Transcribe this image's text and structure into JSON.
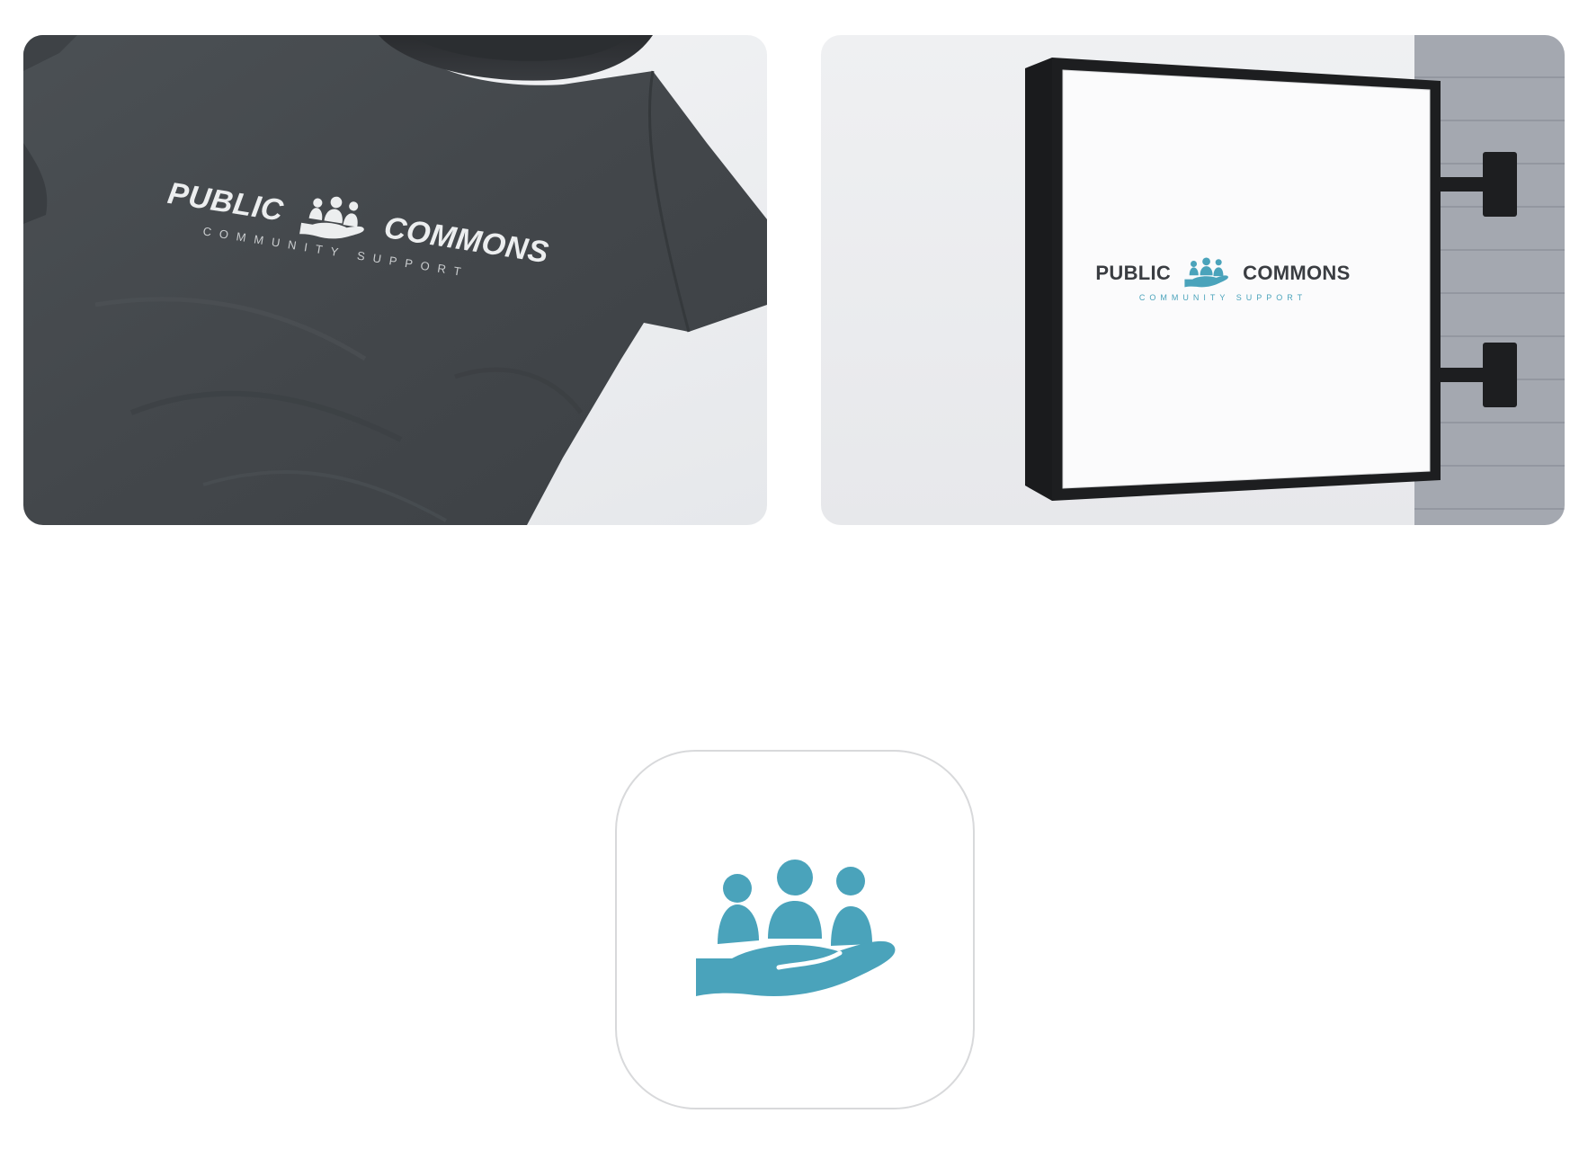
{
  "brand": {
    "name_left": "PUBLIC",
    "name_right": "COMMONS",
    "tagline": "COMMUNITY SUPPORT"
  },
  "mockups": [
    {
      "kind": "t-shirt",
      "shirt_color": "#44484c",
      "logo_color": "#eceeef"
    },
    {
      "kind": "hanging-sign",
      "panel_color": "#ffffff",
      "frame_color": "#1d1e20",
      "wordmark_color": "#3a3d42",
      "accent": "#4aa3bb"
    }
  ],
  "app_icon": {
    "icon": "community-support-icon",
    "color": "#4aa3bb"
  },
  "colors": {
    "accent": "#4aa3bb",
    "dark": "#3a3d42",
    "background": "#ffffff"
  }
}
